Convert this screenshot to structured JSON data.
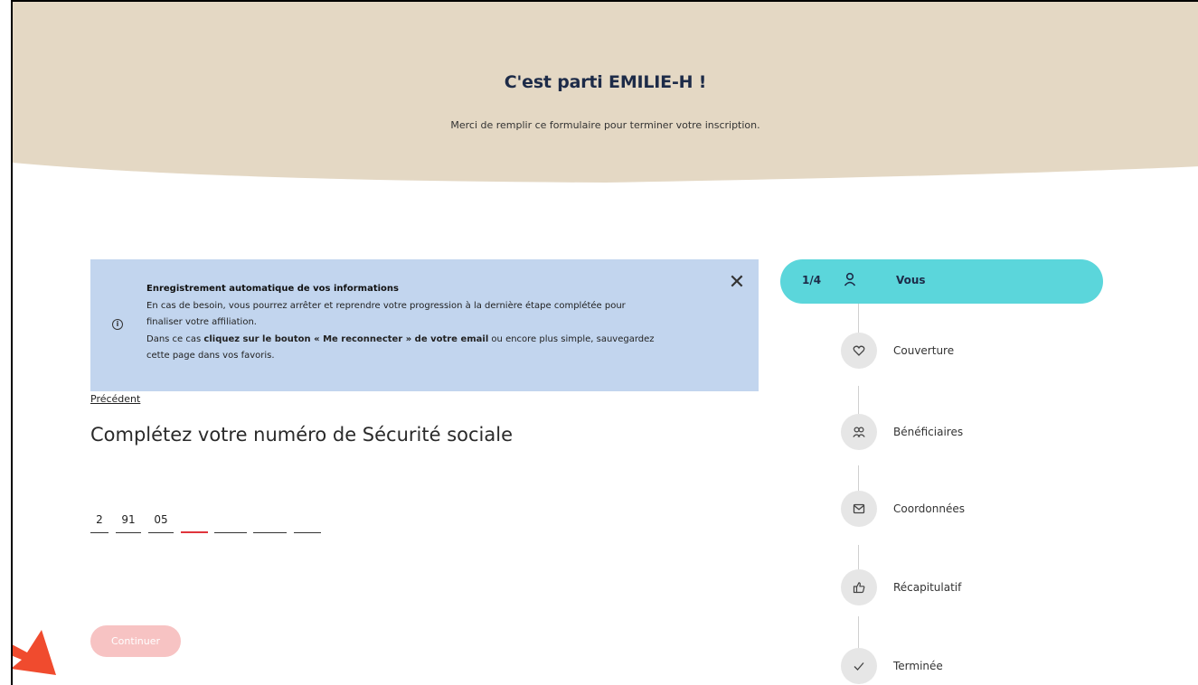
{
  "header": {
    "title": "C'est parti EMILIE-H !",
    "subtitle": "Merci de remplir ce formulaire pour terminer votre inscription."
  },
  "notice": {
    "heading": "Enregistrement automatique de vos informations",
    "line1": "En cas de besoin, vous pourrez arrêter et reprendre votre progression à la dernière étape complétée pour",
    "line2": "finaliser votre affiliation.",
    "line3_start": "Dans ce cas ",
    "line3_bold": "cliquez sur le bouton « Me reconnecter » de votre email",
    "line3_end": " ou encore plus simple, sauvegardez",
    "line4": "cette page dans vos favoris.",
    "close_label": "✕"
  },
  "form": {
    "previous_link": "Précédent",
    "title": "Complétez votre numéro de Sécurité sociale",
    "ssn_segments": [
      "2",
      "91",
      "05",
      "",
      "",
      "",
      ""
    ],
    "continue_label": "Continuer"
  },
  "stepper": {
    "current_step": "1/4",
    "steps": [
      {
        "label": "Vous",
        "icon": "user-icon",
        "active": true
      },
      {
        "label": "Couverture",
        "icon": "heart-icon"
      },
      {
        "label": "Bénéficiaires",
        "icon": "users-icon"
      },
      {
        "label": "Coordonnées",
        "icon": "mail-icon"
      },
      {
        "label": "Récapitulatif",
        "icon": "thumbs-up-icon"
      },
      {
        "label": "Terminée",
        "icon": "check-icon"
      }
    ]
  },
  "colors": {
    "header_bg": "#e4d8c4",
    "notice_bg": "#c2d5ee",
    "active_step": "#5bd6db",
    "continue_disabled": "#f7c3c3",
    "ssn_active_underline": "#e0343c",
    "annotation_arrow": "#f04b2e"
  }
}
